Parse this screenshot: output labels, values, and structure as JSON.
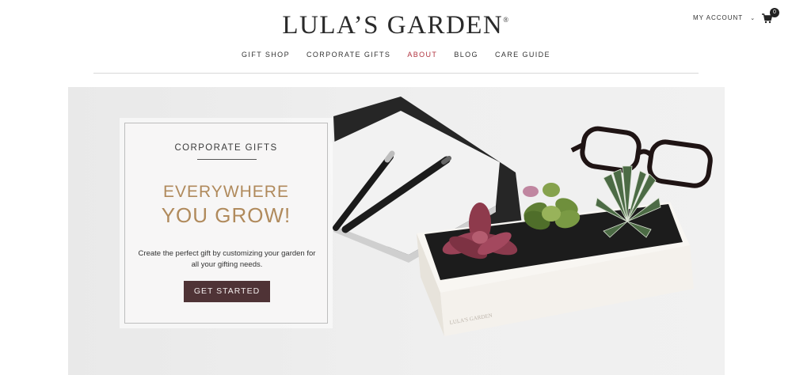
{
  "header": {
    "logo_text": "LULA’S GARDEN",
    "logo_mark": "®",
    "account_label": "MY ACCOUNT",
    "cart_count": "0"
  },
  "nav": {
    "items": [
      {
        "label": "GIFT SHOP"
      },
      {
        "label": "CORPORATE GIFTS"
      },
      {
        "label": "ABOUT"
      },
      {
        "label": "BLOG"
      },
      {
        "label": "CARE GUIDE"
      }
    ],
    "active_index": 2
  },
  "hero": {
    "card": {
      "eyebrow": "CORPORATE GIFTS",
      "headline_line1": "EVERYWHERE",
      "headline_line2": "YOU GROW!",
      "body": "Create the perfect gift by customizing your garden for all your gifting needs.",
      "button_label": "GET STARTED"
    },
    "box_imprint": "LULA'S GARDEN"
  },
  "colors": {
    "nav_active": "#b0313d",
    "headline_gold": "#b08a5c",
    "button_bg": "#4f3336",
    "background": "#ffffff"
  },
  "icons": [
    "cart-icon",
    "chevron-down-icon"
  ]
}
